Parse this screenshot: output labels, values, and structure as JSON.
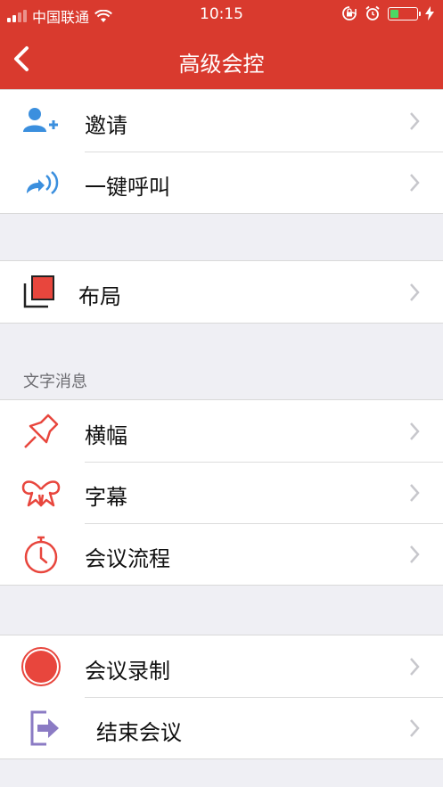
{
  "status_bar": {
    "carrier": "中国联通",
    "time": "10:15"
  },
  "nav": {
    "title": "高级会控"
  },
  "groups": [
    {
      "items": [
        {
          "label": "邀请"
        },
        {
          "label": "一键呼叫"
        }
      ]
    },
    {
      "items": [
        {
          "label": "布局"
        }
      ]
    },
    {
      "header": "文字消息",
      "items": [
        {
          "label": "横幅"
        },
        {
          "label": "字幕"
        },
        {
          "label": "会议流程"
        }
      ]
    },
    {
      "items": [
        {
          "label": "会议录制"
        },
        {
          "label": "结束会议"
        }
      ]
    }
  ],
  "icons": {
    "invite": "add-user-icon",
    "call": "call-wave-icon",
    "layout": "layout-icon",
    "banner": "pushpin-icon",
    "subtitle": "ribbon-icon",
    "agenda": "stopwatch-icon",
    "record": "record-icon",
    "end": "exit-icon"
  },
  "colors": {
    "accent": "#d93a2e",
    "blue": "#3b8fde",
    "red_icon": "#e8463d",
    "purple": "#8b7bc4"
  }
}
